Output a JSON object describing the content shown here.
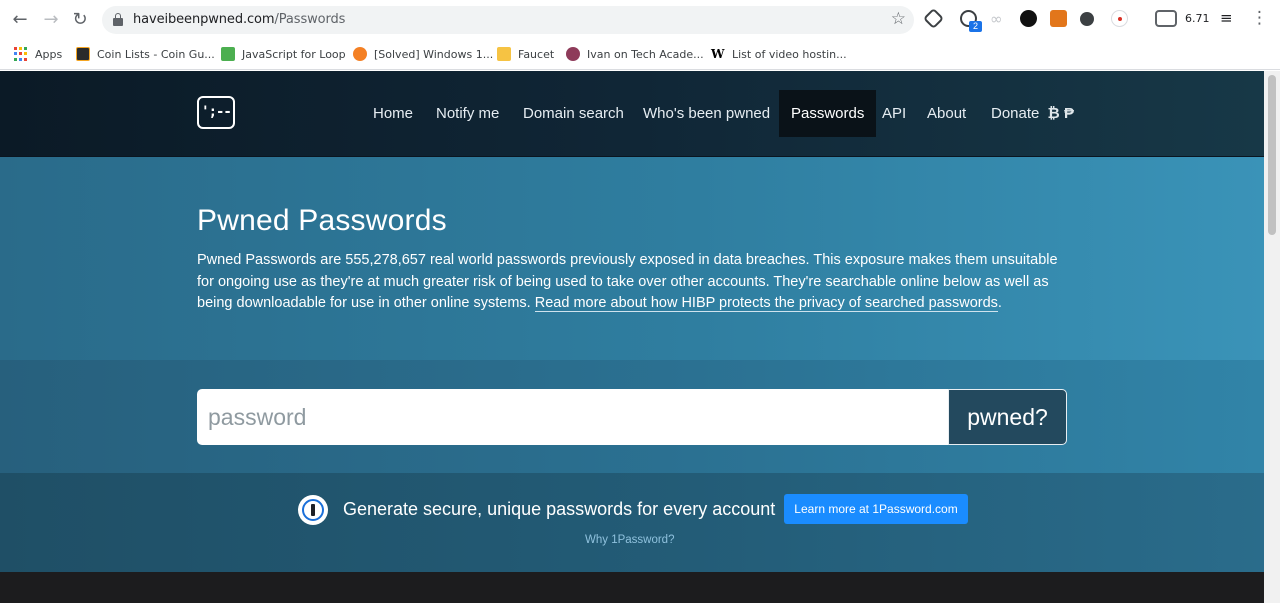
{
  "browser": {
    "url_domain": "haveibeenpwned.com",
    "url_path": "/Passwords",
    "extension_badge": "2",
    "extension_value": "6.71"
  },
  "bookmarks": [
    {
      "label": "Apps",
      "icon": "apps-grid-icon"
    },
    {
      "label": "Coin Lists - Coin Gu...",
      "icon": "coin-lists-icon"
    },
    {
      "label": "JavaScript for Loop",
      "icon": "w3schools-icon"
    },
    {
      "label": "[Solved] Windows 1...",
      "icon": "stackexchange-icon"
    },
    {
      "label": "Faucet",
      "icon": "folder-icon"
    },
    {
      "label": "Ivan on Tech Acade...",
      "icon": "ivan-on-tech-icon"
    },
    {
      "label": "List of video hostin...",
      "icon": "wikipedia-icon"
    }
  ],
  "site": {
    "logo_text": "';--",
    "nav": [
      "Home",
      "Notify me",
      "Domain search",
      "Who's been pwned",
      "Passwords",
      "API",
      "About",
      "Donate"
    ],
    "active_nav": "Passwords",
    "donate_icons": "₿ ₱"
  },
  "hero": {
    "title": "Pwned Passwords",
    "body": "Pwned Passwords are 555,278,657 real world passwords previously exposed in data breaches. This exposure makes them unsuitable for ongoing use as they're at much greater risk of being used to take over other accounts. They're searchable online below as well as being downloadable for use in other online systems.",
    "link": "Read more about how HIBP protects the privacy of searched passwords",
    "link_suffix": "."
  },
  "search": {
    "placeholder": "password",
    "button": "pwned?"
  },
  "promo": {
    "text": "Generate secure, unique passwords for every account",
    "button": "Learn more at 1Password.com",
    "link": "Why 1Password?"
  },
  "colors": {
    "nav_bg": "#0b1a26",
    "hero_bg": "#2f7ea0",
    "promo_button": "#1a8cff"
  }
}
